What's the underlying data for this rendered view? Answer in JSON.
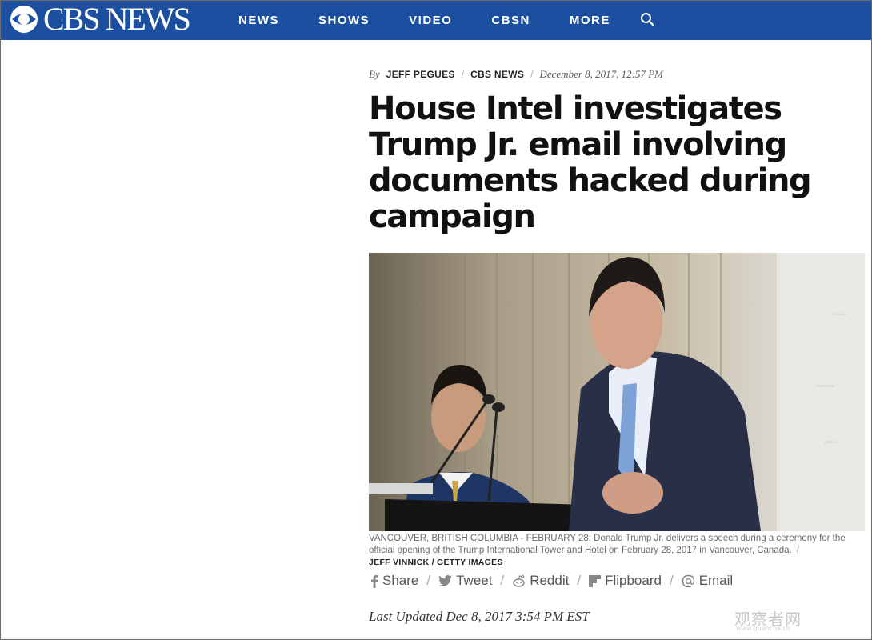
{
  "header": {
    "logo_text": "CBS NEWS",
    "nav": [
      "NEWS",
      "SHOWS",
      "VIDEO",
      "CBSN",
      "MORE"
    ],
    "accent_color": "#1c4fa0",
    "search_icon": "search-icon"
  },
  "article": {
    "byline": {
      "by": "By",
      "author": "JEFF PEGUES",
      "source": "CBS NEWS",
      "date": "December 8, 2017, 12:57 PM"
    },
    "headline": "House Intel investigates Trump Jr. email involving documents hacked during campaign",
    "photo_caption": "VANCOUVER, BRITISH COLUMBIA - FEBRUARY 28: Donald Trump Jr. delivers a speech during a ceremony for the official opening of the Trump International Tower and Hotel on February 28, 2017 in Vancouver, Canada.",
    "photo_credit": "JEFF VINNICK / GETTY IMAGES",
    "share": [
      {
        "label": "Share",
        "icon": "facebook-icon"
      },
      {
        "label": "Tweet",
        "icon": "twitter-icon"
      },
      {
        "label": "Reddit",
        "icon": "reddit-icon"
      },
      {
        "label": "Flipboard",
        "icon": "flipboard-icon"
      },
      {
        "label": "Email",
        "icon": "email-at-icon"
      }
    ],
    "last_updated": "Last Updated Dec 8, 2017 3:54 PM EST"
  },
  "watermark": {
    "text": "观察者网",
    "sub": "www.guancha.cn"
  }
}
